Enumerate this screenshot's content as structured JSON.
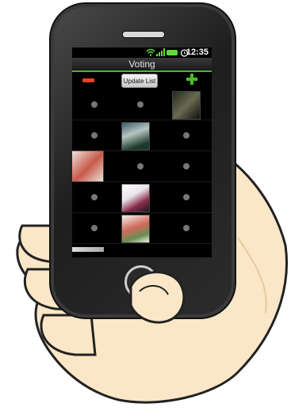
{
  "status": {
    "time": "12:35"
  },
  "header": {
    "title": "Voting"
  },
  "toolbar": {
    "update_label": "Update List"
  },
  "colors": {
    "accent": "#47b82a",
    "remove": "#e8411f",
    "add": "#4dbd2b"
  },
  "grid": {
    "rows": [
      [
        "dot",
        "dot",
        "art"
      ],
      [
        "dot",
        "art",
        "dot"
      ],
      [
        "art",
        "dot",
        "dot"
      ],
      [
        "dot",
        "art",
        "dot"
      ],
      [
        "dot",
        "art",
        "dot"
      ]
    ]
  }
}
